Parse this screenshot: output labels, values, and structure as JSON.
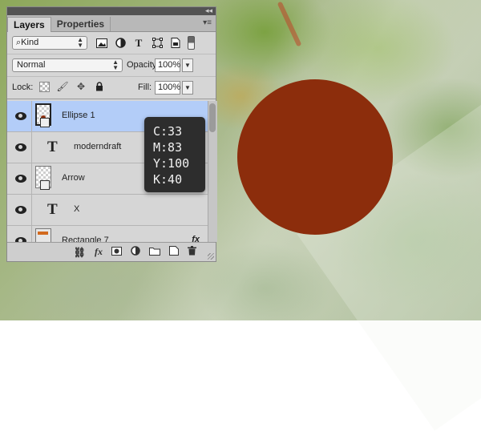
{
  "panel": {
    "tabs": [
      {
        "label": "Layers",
        "active": true
      },
      {
        "label": "Properties",
        "active": false
      }
    ],
    "filter": {
      "kind_label": "Kind"
    },
    "blend_mode": "Normal",
    "opacity": {
      "label": "Opacity:",
      "value": "100%"
    },
    "lock": {
      "label": "Lock:"
    },
    "fill": {
      "label": "Fill:",
      "value": "100%"
    }
  },
  "layers": [
    {
      "name": "Ellipse 1",
      "kind": "shape",
      "selected": true
    },
    {
      "name": "moderndraft",
      "kind": "text",
      "selected": false
    },
    {
      "name": "Arrow",
      "kind": "shape",
      "selected": false
    },
    {
      "name": "X",
      "kind": "text",
      "selected": false
    },
    {
      "name": "Rectangle 7",
      "kind": "shape",
      "selected": false,
      "fx": "fx"
    }
  ],
  "bottom_bar": {
    "fx_label": "fx"
  },
  "tooltip": {
    "lines": [
      "C:33",
      "M:83",
      "Y:100",
      "K:40"
    ]
  },
  "canvas": {
    "ellipse_color": "#8c2d0c"
  }
}
